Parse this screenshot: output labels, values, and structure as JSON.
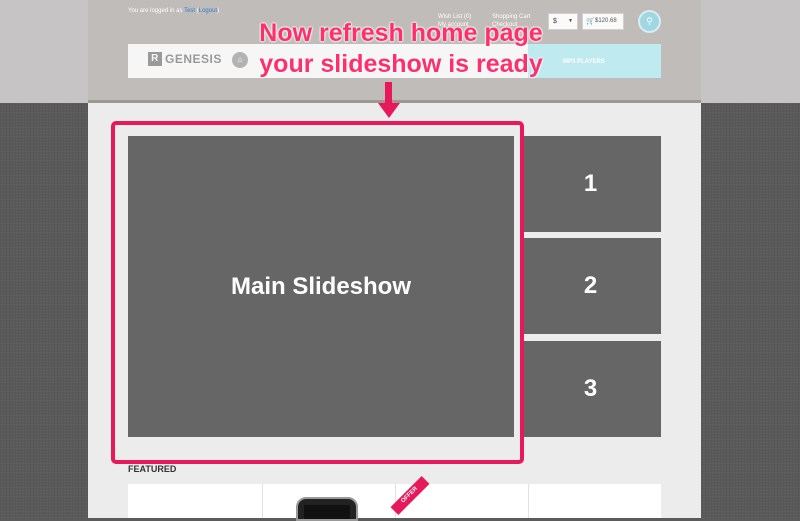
{
  "header": {
    "logged_in_prefix": "You are logged in as",
    "username": "Test",
    "logout_label": "Logout",
    "wishlist_label": "Wish List (0)",
    "account_label": "My account",
    "cart_label": "Shopping Cart",
    "checkout_label": "Checkout",
    "currency_value": "$",
    "cart_total": "$120.68"
  },
  "nav": {
    "logo_mark": "R",
    "logo_text": "GENESIS",
    "items": [
      {
        "label": "MP3 PLAYERS"
      }
    ]
  },
  "annotation": {
    "line1": "Now refresh home page",
    "line2": "your slideshow is ready"
  },
  "slideshow": {
    "main_label": "Main Slideshow",
    "thumbs": [
      "1",
      "2",
      "3"
    ]
  },
  "featured": {
    "title": "FEATURED",
    "offer_label": "OFFER"
  },
  "colors": {
    "accent": "#e8195a",
    "callout_text": "#ff2f6d",
    "slide_bg": "#666666",
    "nav_highlight": "#bfeaef"
  },
  "icons": {
    "home": "home-icon",
    "search": "search-icon",
    "cart": "cart-icon"
  }
}
